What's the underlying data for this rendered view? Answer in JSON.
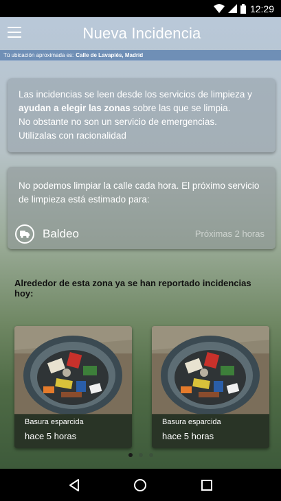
{
  "status_bar": {
    "time": "12:29",
    "icons": [
      "wifi-icon",
      "signal-icon",
      "battery-icon"
    ]
  },
  "app_bar": {
    "title": "Nueva Incidencia",
    "menu_icon": "hamburger-icon"
  },
  "location": {
    "prefix": "Tú ubicación aproximada es:",
    "address": "Calle de Lavapiés, Madrid"
  },
  "info_card": {
    "line1": "Las incidencias se leen desde los servicios de limpieza y",
    "bold": "ayudan a elegir las zonas",
    "line2_rest": " sobre las que se limpia.",
    "line3": "No obstante no son un servicio de emergencias.",
    "line4": "Utilízalas con racionalidad"
  },
  "service_card": {
    "text": "No podemos limpiar la calle cada hora. El próximo servicio de limpieza está estimado para:",
    "service_icon": "truck-icon",
    "service_name": "Baldeo",
    "service_time": "Próximas 2 horas"
  },
  "nearby": {
    "title": "Alrededor de esta zona ya se han reportado incidencias hoy:",
    "items": [
      {
        "type": "Basura esparcida",
        "time": "hace 5 horas"
      },
      {
        "type": "Basura esparcida",
        "time": "hace 5 horas"
      }
    ],
    "page_count": 3,
    "active_page": 0
  },
  "nav": {
    "back_icon": "back-triangle-icon",
    "home_icon": "home-circle-icon",
    "recents_icon": "recents-square-icon"
  },
  "colors": {
    "location_bar": "#6f8fb6",
    "status_bar": "#000000"
  }
}
